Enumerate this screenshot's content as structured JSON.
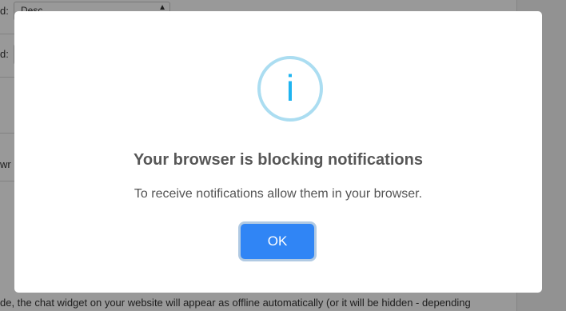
{
  "background": {
    "row1_label": "d:",
    "row1_select_value": "Desc",
    "row2_label": "d:",
    "row3_label": "wr",
    "bottom_text": "de, the chat widget on your website will appear as offline automatically (or it will be hidden - depending"
  },
  "dialog": {
    "icon": "info-icon",
    "icon_glyph": "i",
    "title": "Your browser is blocking notifications",
    "text": "To receive notifications allow them in your browser.",
    "ok_label": "OK"
  },
  "colors": {
    "overlay": "rgba(0,0,0,0.4)",
    "icon_ring": "#87ceeb",
    "icon_glyph": "#1fb4f0",
    "button": "#3085f5",
    "title": "#575757",
    "text": "#545454"
  }
}
